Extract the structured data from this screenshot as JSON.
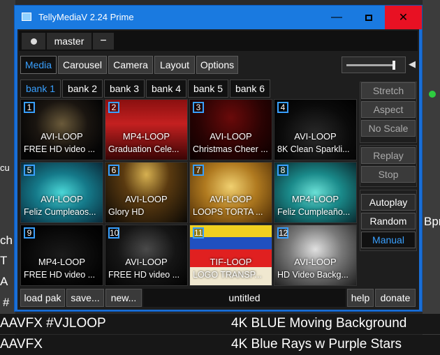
{
  "window": {
    "title": "TellyMediaV 2.24 Prime"
  },
  "topbar": {
    "master_label": "master",
    "minus_label": "−"
  },
  "tabs": [
    "Media",
    "Carousel",
    "Camera",
    "Layout",
    "Options"
  ],
  "active_tab": "Media",
  "banks": [
    "bank 1",
    "bank 2",
    "bank 3",
    "bank 4",
    "bank 5",
    "bank 6"
  ],
  "active_bank": "bank 1",
  "cells": [
    {
      "num": "1",
      "type": "AVI-LOOP",
      "name": "FREE HD video ..."
    },
    {
      "num": "2",
      "type": "MP4-LOOP",
      "name": "Graduation Cele..."
    },
    {
      "num": "3",
      "type": "AVI-LOOP",
      "name": "Christmas Cheer ..."
    },
    {
      "num": "4",
      "type": "AVI-LOOP",
      "name": "8K Clean Sparkli..."
    },
    {
      "num": "5",
      "type": "AVI-LOOP",
      "name": "Feliz Cumpleaos..."
    },
    {
      "num": "6",
      "type": "AVI-LOOP",
      "name": "Glory   HD"
    },
    {
      "num": "7",
      "type": "AVI-LOOP",
      "name": "LOOPS TORTA ..."
    },
    {
      "num": "8",
      "type": "MP4-LOOP",
      "name": "Feliz Cumpleaño..."
    },
    {
      "num": "9",
      "type": "MP4-LOOP",
      "name": "FREE HD video ..."
    },
    {
      "num": "10",
      "type": "AVI-LOOP",
      "name": "FREE HD video ..."
    },
    {
      "num": "11",
      "type": "TIF-LOOP",
      "name": "LOGO TRANSP..."
    },
    {
      "num": "12",
      "type": "AVI-LOOP",
      "name": "HD Video Backg..."
    }
  ],
  "side": {
    "stretch": "Stretch",
    "aspect": "Aspect",
    "noscale": "No Scale",
    "replay": "Replay",
    "stop": "Stop",
    "autoplay": "Autoplay",
    "random": "Random",
    "manual": "Manual"
  },
  "bottom": {
    "load": "load pak",
    "save": "save...",
    "new": "new...",
    "file": "untitled",
    "help": "help",
    "donate": "donate"
  },
  "background": {
    "row1_left": "AAVFX #VJLOOP",
    "row1_right": "4K BLUE Moving Background",
    "row2_left": "AAVFX",
    "row2_right": "4K Blue Rays w Purple Stars",
    "frag_cu": "cu",
    "frag_ch": "ch",
    "frag_t": "T",
    "frag_a": "A",
    "frag_hash": "#",
    "frag_bpr": "Bpr"
  }
}
